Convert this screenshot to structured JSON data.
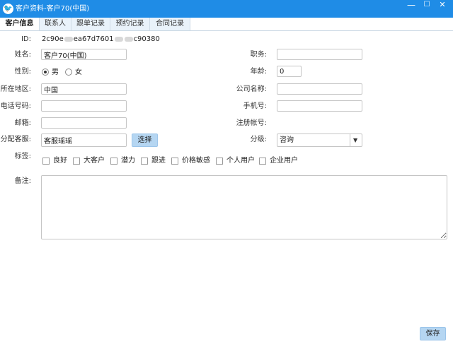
{
  "window": {
    "title": "客户资料-客户70(中国)",
    "app_icon": "bird-logo-icon",
    "minimize_glyph": "—",
    "maximize_glyph": "☐",
    "close_glyph": "✕"
  },
  "tabs": [
    {
      "label": "客户信息",
      "active": true
    },
    {
      "label": "联系人",
      "active": false
    },
    {
      "label": "跟单记录",
      "active": false
    },
    {
      "label": "预约记录",
      "active": false
    },
    {
      "label": "合同记录",
      "active": false
    }
  ],
  "form": {
    "id_label": "ID:",
    "id_value_start": "2c90e",
    "id_value_mid1": "ea67d7601",
    "id_value_end": "c90380",
    "name_label": "姓名:",
    "name_value": "客户70(中国)",
    "position_label": "职务:",
    "position_value": "",
    "gender_label": "性别:",
    "gender_options": [
      "男",
      "女"
    ],
    "gender_selected": "男",
    "age_label": "年龄:",
    "age_value": "0",
    "region_label": "所在地区:",
    "region_value": "中国",
    "company_label": "公司名称:",
    "company_value": "",
    "phone_label": "电话号码:",
    "phone_value": "",
    "mobile_label": "手机号:",
    "mobile_value": "",
    "email_label": "邮箱:",
    "email_value": "",
    "register_label": "注册帐号:",
    "assign_label": "分配客服:",
    "assign_value": "客服瑶瑶",
    "select_button": "选择",
    "grade_label": "分级:",
    "grade_value": "咨询",
    "tags_label": "标签:",
    "tags": [
      "良好",
      "大客户",
      "潜力",
      "跟进",
      "价格敏感",
      "个人用户",
      "企业用户"
    ],
    "notes_label": "备注:",
    "notes_value": ""
  },
  "footer": {
    "save_button": "保存"
  }
}
